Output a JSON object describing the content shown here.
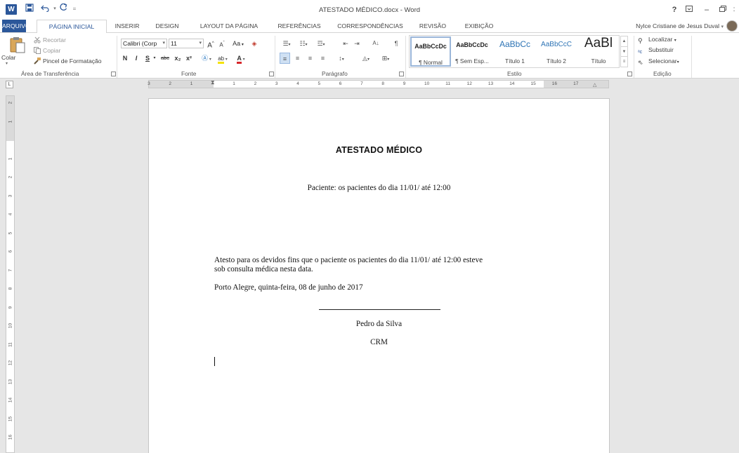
{
  "window": {
    "title": "ATESTADO MÉDICO.docx - Word",
    "controls": {
      "help": "?",
      "restore_ribbon": "⧉",
      "minimize": "–",
      "maximize": "🗗"
    }
  },
  "quick_access": {
    "save_icon": "save-icon",
    "undo_icon": "undo-icon",
    "redo_icon": "redo-icon",
    "customize_icon": "customize-icon"
  },
  "tabs": [
    {
      "label": "ARQUIVO"
    },
    {
      "label": "PÁGINA INICIAL"
    },
    {
      "label": "INSERIR"
    },
    {
      "label": "DESIGN"
    },
    {
      "label": "LAYOUT DA PÁGINA"
    },
    {
      "label": "REFERÊNCIAS"
    },
    {
      "label": "CORRESPONDÊNCIAS"
    },
    {
      "label": "REVISÃO"
    },
    {
      "label": "EXIBIÇÃO"
    }
  ],
  "user": {
    "name": "Nylce Cristiane de Jesus Duval"
  },
  "ribbon": {
    "clipboard": {
      "paste_label": "Colar",
      "cut_label": "Recortar",
      "copy_label": "Copiar",
      "format_painter_label": "Pincel de Formatação",
      "group_label": "Área de Transferência"
    },
    "font": {
      "family_value": "Calibri (Corp",
      "size_value": "11",
      "grow_label": "A",
      "shrink_label": "A",
      "case_label": "Aa",
      "bold_label": "N",
      "italic_label": "I",
      "underline_label": "S",
      "strike_label": "abc",
      "subscript_label": "x₂",
      "superscript_label": "x²",
      "group_label": "Fonte"
    },
    "paragraph": {
      "sort_label": "A↓",
      "pilcrow_label": "¶",
      "group_label": "Parágrafo"
    },
    "styles": {
      "items": [
        {
          "sample": "AaBbCcDc",
          "name": "¶ Normal"
        },
        {
          "sample": "AaBbCcDc",
          "name": "¶ Sem Esp..."
        },
        {
          "sample": "AaBbCc",
          "name": "Título 1"
        },
        {
          "sample": "AaBbCcC",
          "name": "Título 2"
        },
        {
          "sample": "AaBl",
          "name": "Título"
        }
      ],
      "group_label": "Estilo"
    },
    "editing": {
      "find_label": "Localizar",
      "replace_label": "Substituir",
      "select_label": "Selecionar",
      "group_label": "Edição"
    }
  },
  "rulers": {
    "tab_selector": "L",
    "h_numbers": [
      "3",
      "2",
      "1",
      "1",
      "2",
      "3",
      "4",
      "5",
      "6",
      "7",
      "8",
      "9",
      "10",
      "11",
      "12",
      "13",
      "14",
      "15",
      "16",
      "17"
    ],
    "v_numbers": [
      "2",
      "1",
      "1",
      "2",
      "3",
      "4",
      "5",
      "6",
      "7",
      "8",
      "9",
      "10",
      "11",
      "12",
      "13",
      "14",
      "15",
      "16"
    ]
  },
  "document": {
    "heading": "ATESTADO MÉDICO",
    "patient_line": "Paciente:  os pacientes do dia 11/01/ até 12:00",
    "body_line1": "Atesto para os devidos fins que o paciente os pacientes do dia 11/01/ até 12:00 esteve",
    "body_line2": "sob consulta médica nesta data.",
    "place_date": "Porto Alegre, quinta-feira, 08 de junho de 2017",
    "signer_name": "Pedro da Silva",
    "signer_crm": "CRM"
  }
}
